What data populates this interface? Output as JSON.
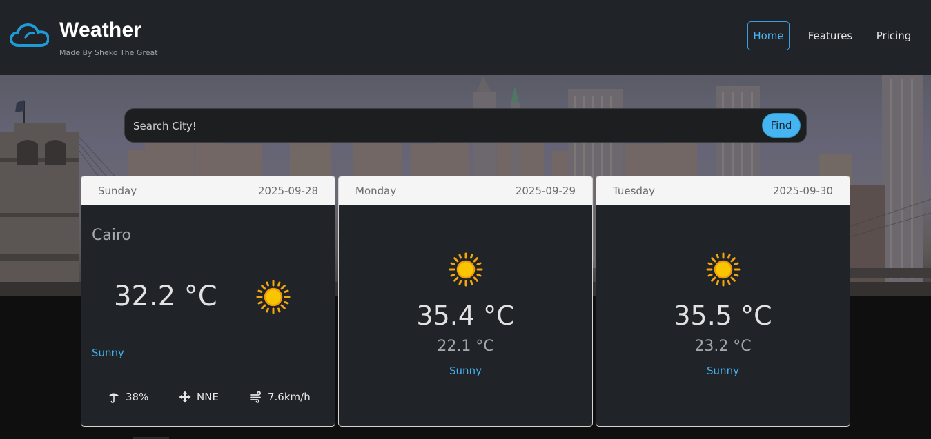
{
  "brand": {
    "icon": "cloud-icon",
    "title": "Weather",
    "subtitle": "Made By Sheko The Great",
    "accent": "#3aa0d8"
  },
  "nav": {
    "home": "Home",
    "features": "Features",
    "pricing": "Pricing"
  },
  "search": {
    "placeholder": "Search City!",
    "value": "",
    "button": "Find"
  },
  "forecast": [
    {
      "day": "Sunday",
      "date": "2025-09-28",
      "city": "Cairo",
      "temp": "32.2 °C",
      "icon": "sun-icon",
      "condition": "Sunny",
      "humidity": "38%",
      "wind_dir": "NNE",
      "wind_speed": "7.6km/h"
    },
    {
      "day": "Monday",
      "date": "2025-09-29",
      "icon": "sun-icon",
      "max_temp": "35.4 °C",
      "min_temp": "22.1 °C",
      "condition": "Sunny"
    },
    {
      "day": "Tuesday",
      "date": "2025-09-30",
      "icon": "sun-icon",
      "max_temp": "35.5 °C",
      "min_temp": "23.2 °C",
      "condition": "Sunny"
    }
  ],
  "colors": {
    "navbar_bg": "#202328",
    "card_bg": "#202327",
    "condition_text": "#44b0ec",
    "find_button": "#46b4f0"
  }
}
